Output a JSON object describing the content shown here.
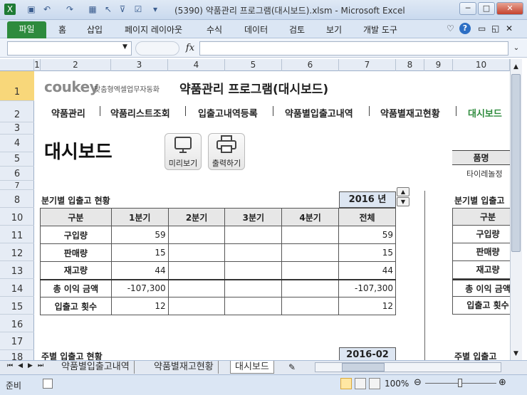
{
  "window": {
    "title": "(5390) 약품관리 프로그램(대시보드).xlsm  -  Microsoft Excel",
    "minimize": "─",
    "maximize": "□",
    "close": "✕"
  },
  "ribbon": {
    "file": "파일",
    "tabs": [
      "홈",
      "삽입",
      "페이지 레이아웃",
      "수식",
      "데이터",
      "검토",
      "보기",
      "개발 도구"
    ]
  },
  "formula_bar": {
    "name_box": "",
    "fx": "fx",
    "formula": ""
  },
  "columns": [
    "1",
    "2",
    "3",
    "4",
    "5",
    "6",
    "7",
    "8",
    "9",
    "10"
  ],
  "rows": [
    "1",
    "2",
    "3",
    "4",
    "5",
    "6",
    "7",
    "8",
    "10",
    "11",
    "12",
    "13",
    "14",
    "15",
    "16",
    "17",
    "18"
  ],
  "header": {
    "logo": "coukey",
    "logo_tagline": "맞춤형엑셀업무자동화",
    "title": "약품관리 프로그램(대시보드)"
  },
  "nav": [
    "약품관리",
    "약품리스트조회",
    "입출고내역등록",
    "약품별입출고내역",
    "약품별재고현황",
    "대시보드"
  ],
  "page_title": "대시보드",
  "buttons": {
    "preview": "미리보기",
    "print": "출력하기"
  },
  "right_panel": {
    "product_header": "품명",
    "product_value": "타이레놀정",
    "quarter_title": "분기별 입출고",
    "weekly_title": "주별 입출고"
  },
  "quarterly": {
    "title": "분기별 입출고 현황",
    "year": "2016 년",
    "headers": [
      "구분",
      "1분기",
      "2분기",
      "3분기",
      "4분기",
      "전체"
    ],
    "rows": [
      [
        "구입량",
        "59",
        "",
        "",
        "",
        "59"
      ],
      [
        "판매량",
        "15",
        "",
        "",
        "",
        "15"
      ],
      [
        "재고량",
        "44",
        "",
        "",
        "",
        "44"
      ],
      [
        "총 이익 금액",
        "-107,300",
        "",
        "",
        "",
        "-107,300"
      ],
      [
        "입출고 횟수",
        "12",
        "",
        "",
        "",
        "12"
      ]
    ]
  },
  "right_labels": [
    "구분",
    "구입량",
    "판매량",
    "재고량",
    "총 이익 금액",
    "입출고 횟수"
  ],
  "weekly": {
    "title": "주별 입출고 현황",
    "period": "2016-02"
  },
  "sheet_tabs": [
    "약품별입출고내역",
    "약품별재고현황",
    "대시보드"
  ],
  "status": {
    "ready": "준비",
    "zoom": "100%"
  }
}
